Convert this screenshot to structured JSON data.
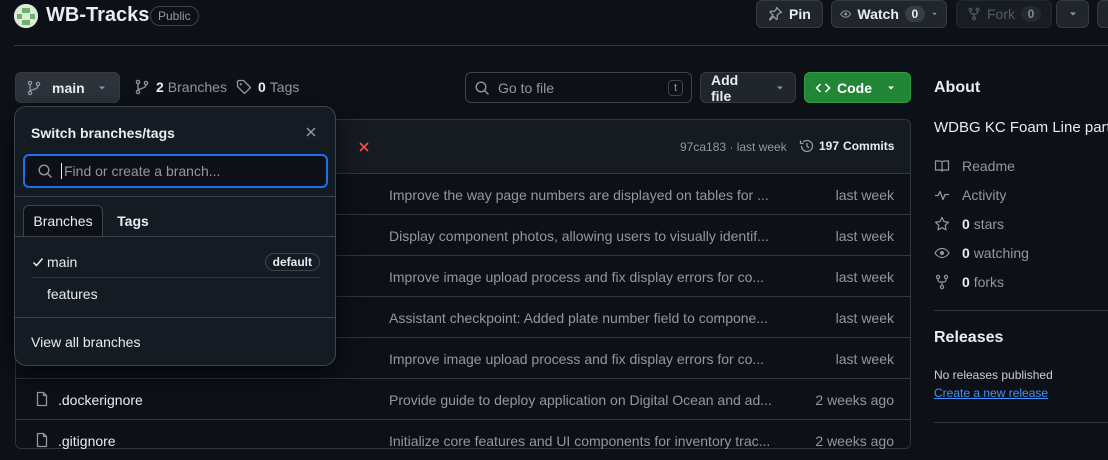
{
  "repo": {
    "name": "WB-Tracks",
    "visibility": "Public"
  },
  "actions": {
    "pin_label": "Pin",
    "watch_label": "Watch",
    "watch_count": "0",
    "fork_label": "Fork",
    "fork_count": "0"
  },
  "branch_bar": {
    "current_branch": "main",
    "branches_count": "2",
    "branches_label": "Branches",
    "tags_count": "0",
    "tags_label": "Tags"
  },
  "goto": {
    "placeholder": "Go to file",
    "shortcut": "t"
  },
  "add_file_label": "Add file",
  "code_label": "Code",
  "commit_bar": {
    "hash": "97ca183 · last week",
    "commits_count": "197",
    "commits_label": "Commits"
  },
  "dropdown": {
    "title": "Switch branches/tags",
    "search_placeholder": "Find or create a branch...",
    "tabs": [
      "Branches",
      "Tags"
    ],
    "branches": [
      {
        "name": "main",
        "badge": "default"
      },
      {
        "name": "features",
        "badge": ""
      }
    ],
    "view_all": "View all branches"
  },
  "files": [
    {
      "name": "",
      "message": "Improve the way page numbers are displayed on tables for ...",
      "time": "last week"
    },
    {
      "name": "",
      "message": "Display component photos, allowing users to visually identif...",
      "time": "last week"
    },
    {
      "name": "",
      "message": "Improve image upload process and fix display errors for co...",
      "time": "last week"
    },
    {
      "name": "",
      "message": "Assistant checkpoint: Added plate number field to compone...",
      "time": "last week"
    },
    {
      "name": "",
      "message": "Improve image upload process and fix display errors for co...",
      "time": "last week"
    },
    {
      "name": ".dockerignore",
      "message": "Provide guide to deploy application on Digital Ocean and ad...",
      "time": "2 weeks ago"
    },
    {
      "name": ".gitignore",
      "message": "Initialize core features and UI components for inventory trac...",
      "time": "2 weeks ago"
    }
  ],
  "about": {
    "heading": "About",
    "description": "WDBG KC Foam Line parts",
    "readme": "Readme",
    "activity": "Activity",
    "stars_count": "0",
    "stars_label": "stars",
    "watching_count": "0",
    "watching_label": "watching",
    "forks_count": "0",
    "forks_label": "forks"
  },
  "releases": {
    "heading": "Releases",
    "none_text": "No releases published",
    "create_link": "Create a new release"
  },
  "colors": {
    "bg": "#0d1117",
    "code_green": "#238636",
    "focus_blue": "#1f6feb",
    "link_blue": "#4493f8",
    "error_red": "#f85149"
  }
}
